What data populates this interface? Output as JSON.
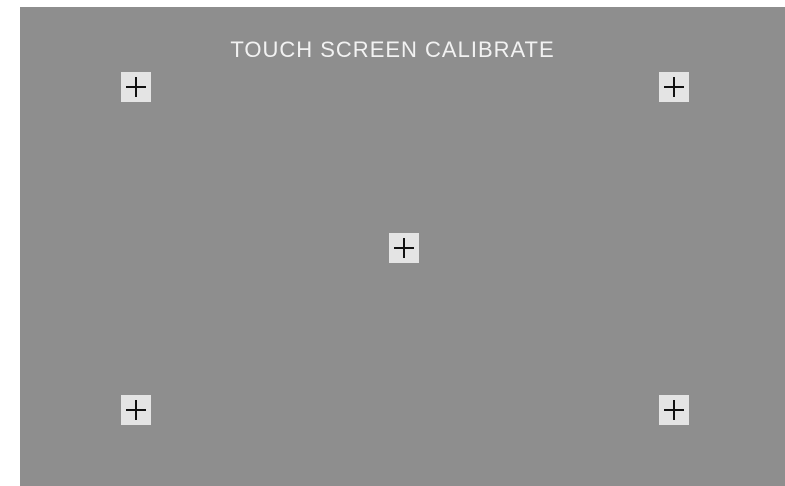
{
  "screen": {
    "title": "TOUCH SCREEN CALIBRATE",
    "background_color": "#8e8e8e",
    "text_color": "#f2f2f2"
  },
  "targets": [
    {
      "id": "top-left",
      "icon": "crosshair-icon"
    },
    {
      "id": "top-right",
      "icon": "crosshair-icon"
    },
    {
      "id": "center",
      "icon": "crosshair-icon"
    },
    {
      "id": "bottom-left",
      "icon": "crosshair-icon"
    },
    {
      "id": "bottom-right",
      "icon": "crosshair-icon"
    }
  ]
}
